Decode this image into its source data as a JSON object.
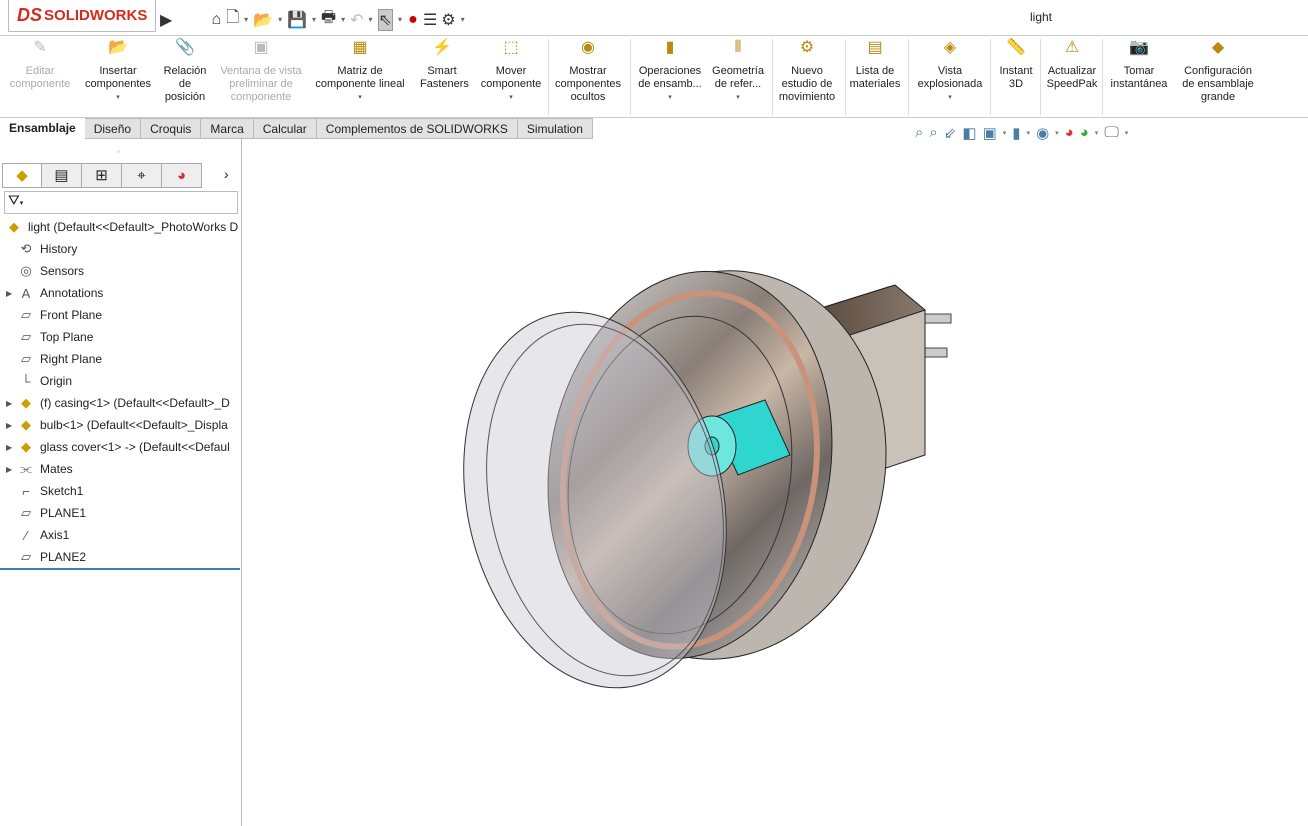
{
  "app": {
    "brand": "SOLIDWORKS",
    "doc_title": "light"
  },
  "quick_access": [
    "home-icon",
    "new-icon",
    "open-icon",
    "save-icon",
    "print-icon",
    "undo-icon",
    "select-icon",
    "rebuild-icon",
    "file-properties-icon",
    "options-icon"
  ],
  "ribbon": [
    {
      "label": "Editar componente",
      "disabled": true,
      "icon": "✎"
    },
    {
      "label": "Insertar componentes",
      "icon": "📂",
      "dropdown": true
    },
    {
      "label": "Relación de posición",
      "icon": "📎"
    },
    {
      "label": "Ventana de vista preliminar de componente",
      "disabled": true,
      "icon": "▣"
    },
    {
      "label": "Matriz de componente lineal",
      "icon": "▦",
      "dropdown": true
    },
    {
      "label": "Smart Fasteners",
      "icon": "⚡"
    },
    {
      "label": "Mover componente",
      "icon": "⬚",
      "dropdown": true
    },
    {
      "label": "Mostrar componentes ocultos",
      "icon": "◉"
    },
    {
      "label": "Operaciones de ensamb...",
      "icon": "▮",
      "dropdown": true
    },
    {
      "label": "Geometría de refer...",
      "icon": "⫴",
      "dropdown": true
    },
    {
      "label": "Nuevo estudio de movimiento",
      "icon": "⚙"
    },
    {
      "label": "Lista de materiales",
      "icon": "▤"
    },
    {
      "label": "Vista explosionada",
      "icon": "◈",
      "dropdown": true
    },
    {
      "label": "Instant 3D",
      "icon": "📏"
    },
    {
      "label": "Actualizar SpeedPak",
      "icon": "⚠"
    },
    {
      "label": "Tomar instantánea",
      "icon": "📷"
    },
    {
      "label": "Configuración de ensamblaje grande",
      "icon": "◆"
    }
  ],
  "tabs": [
    "Ensamblaje",
    "Diseño",
    "Croquis",
    "Marca",
    "Calcular",
    "Complementos de SOLIDWORKS",
    "Simulation"
  ],
  "tree": [
    {
      "label": "light  (Default<<Default>_PhotoWorks D",
      "icon": "assembly-icon",
      "expand": false,
      "top": true
    },
    {
      "label": "History",
      "icon": "history-icon"
    },
    {
      "label": "Sensors",
      "icon": "sensors-icon"
    },
    {
      "label": "Annotations",
      "icon": "annotations-icon",
      "expand": true
    },
    {
      "label": "Front Plane",
      "icon": "plane-icon"
    },
    {
      "label": "Top Plane",
      "icon": "plane-icon"
    },
    {
      "label": "Right Plane",
      "icon": "plane-icon"
    },
    {
      "label": "Origin",
      "icon": "origin-icon"
    },
    {
      "label": "(f) casing<1> (Default<<Default>_D",
      "icon": "part-icon",
      "expand": true
    },
    {
      "label": "bulb<1> (Default<<Default>_Displa",
      "icon": "part-icon",
      "expand": true
    },
    {
      "label": "glass cover<1> -> (Default<<Defaul",
      "icon": "part-icon",
      "expand": true
    },
    {
      "label": "Mates",
      "icon": "mates-icon",
      "expand": true
    },
    {
      "label": "Sketch1",
      "icon": "sketch-icon"
    },
    {
      "label": "PLANE1",
      "icon": "plane-icon"
    },
    {
      "label": "Axis1",
      "icon": "axis-icon"
    },
    {
      "label": "PLANE2",
      "icon": "plane-icon"
    }
  ],
  "colors": {
    "accent": "#d52b1e",
    "bulb": "#2fd6d0",
    "selection": "#3a80c0"
  }
}
